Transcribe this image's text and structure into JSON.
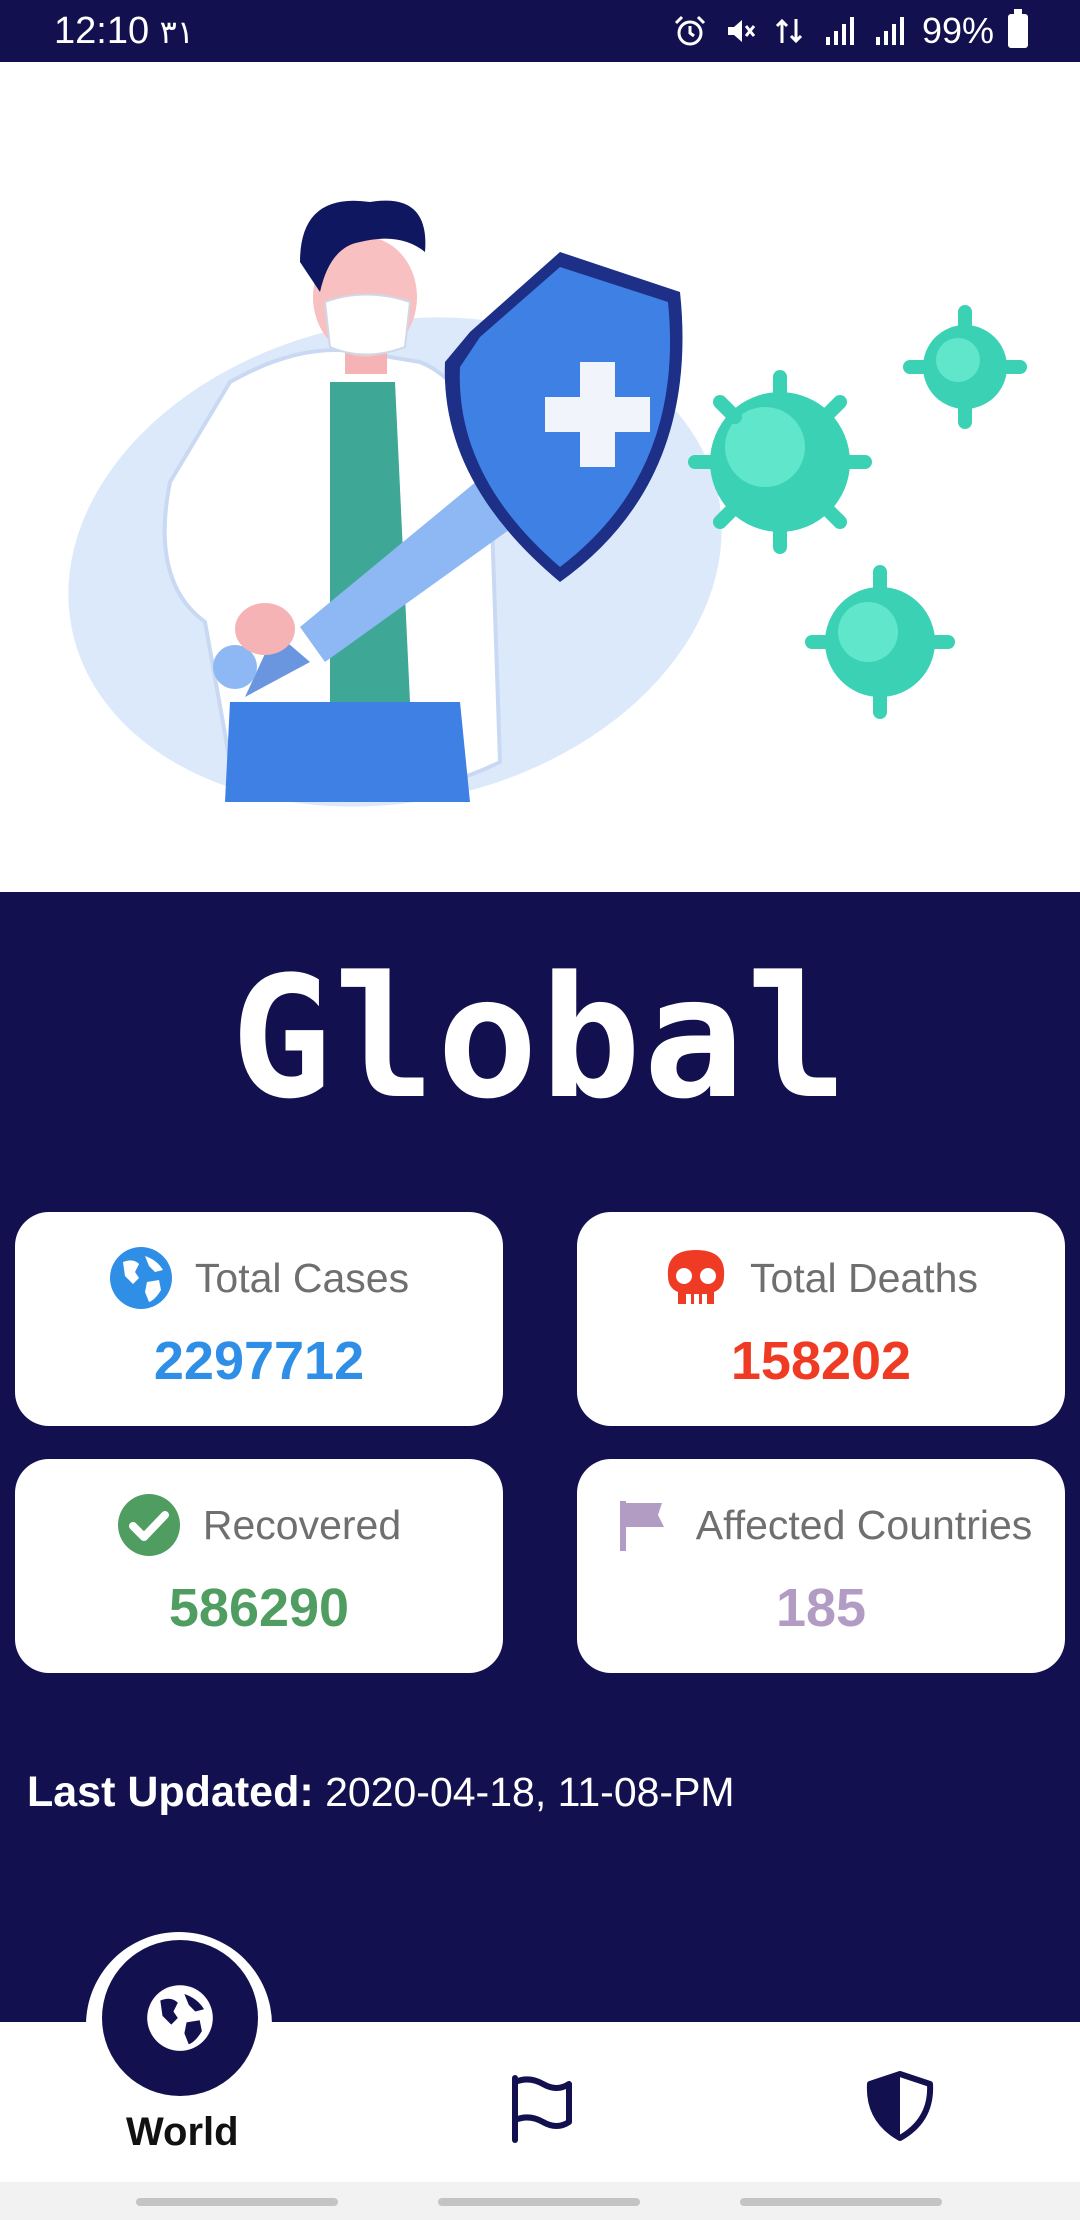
{
  "status_bar": {
    "time": "12:10",
    "date_extra": "٣١",
    "battery": "99%",
    "icons": [
      "alarm-icon",
      "mute-icon",
      "data-icon",
      "signal-icon",
      "signal-icon",
      "battery-icon"
    ]
  },
  "hero": {
    "illustration": "doctor-shield-virus-illustration"
  },
  "title": "Global",
  "stats": {
    "total_cases": {
      "label": "Total Cases",
      "value": "2297712",
      "color": "#2f8fe6",
      "icon": "globe-icon"
    },
    "total_deaths": {
      "label": "Total Deaths",
      "value": "158202",
      "color": "#ef3b24",
      "icon": "skull-icon"
    },
    "recovered": {
      "label": "Recovered",
      "value": "586290",
      "color": "#4f9d61",
      "icon": "check-circle-icon"
    },
    "affected_countries": {
      "label": "Affected Countries",
      "value": "185",
      "color": "#b39cc3",
      "icon": "flag-icon"
    }
  },
  "last_updated": {
    "label": "Last Updated:",
    "value": "2020-04-18, 11-08-PM"
  },
  "nav": {
    "items": [
      {
        "label": "World",
        "icon": "globe-icon",
        "active": true
      },
      {
        "label": "",
        "icon": "flag-icon",
        "active": false
      },
      {
        "label": "",
        "icon": "shield-icon",
        "active": false
      }
    ]
  },
  "colors": {
    "primary": "#13104f",
    "card_bg": "#ffffff"
  }
}
